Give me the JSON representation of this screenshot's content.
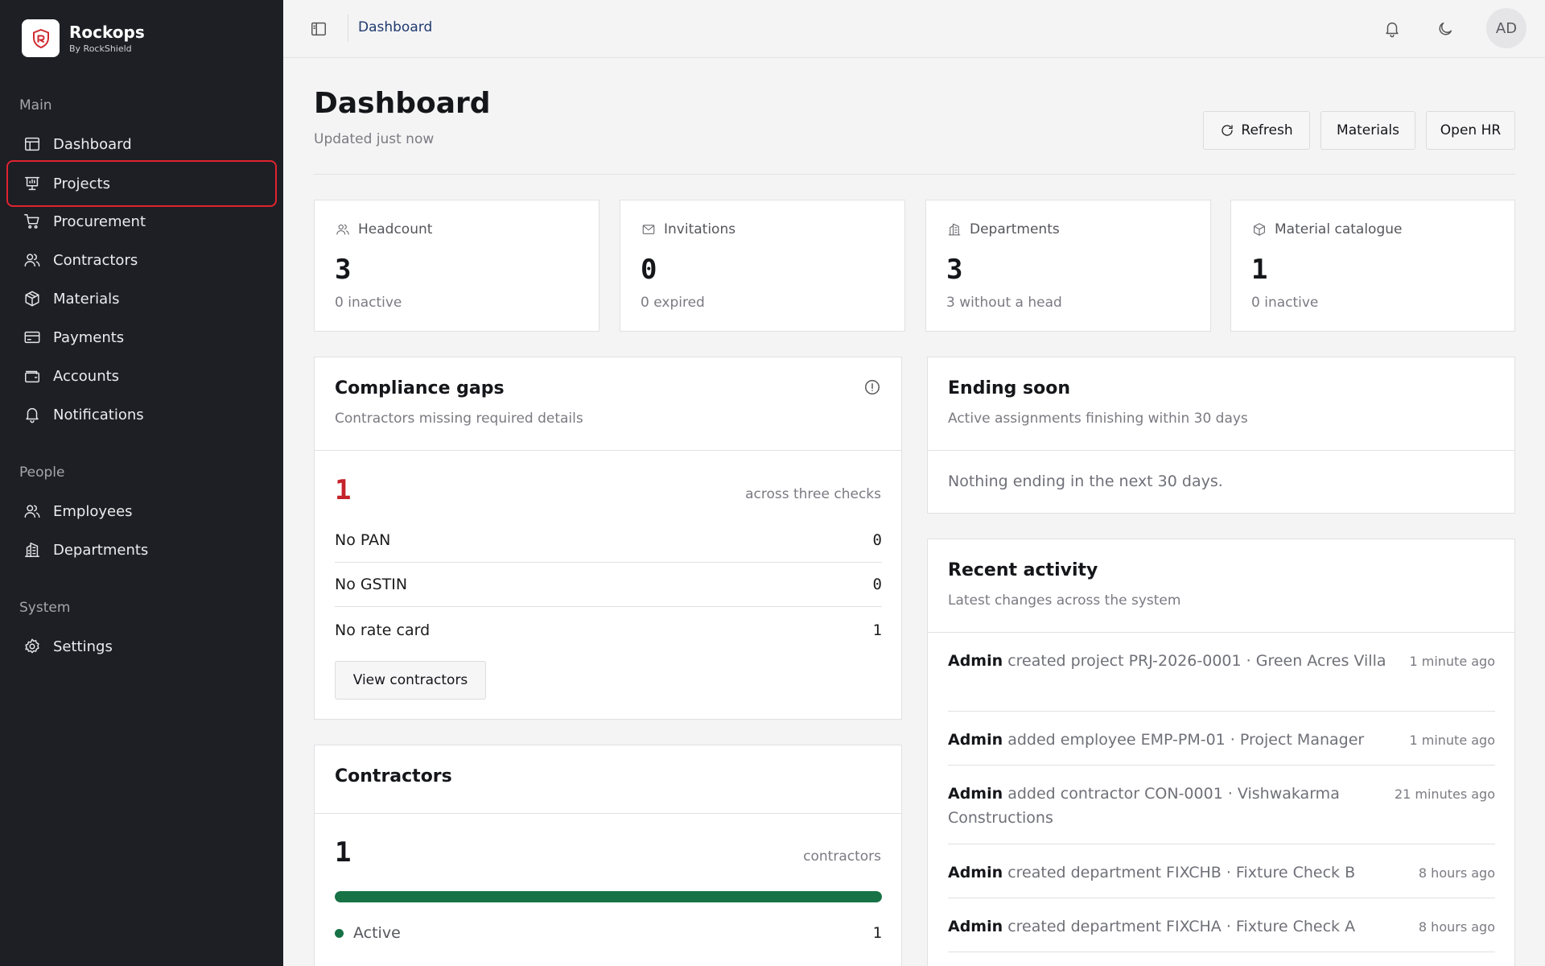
{
  "brand": {
    "name": "Rockops",
    "sub": "By RockShield"
  },
  "sidebar": {
    "groups": [
      {
        "label": "Main",
        "items": [
          {
            "label": "Dashboard",
            "icon": "layout-icon"
          },
          {
            "label": "Projects",
            "icon": "presentation-icon"
          },
          {
            "label": "Procurement",
            "icon": "cart-icon"
          },
          {
            "label": "Contractors",
            "icon": "users-icon"
          },
          {
            "label": "Materials",
            "icon": "package-icon"
          },
          {
            "label": "Payments",
            "icon": "credit-card-icon"
          },
          {
            "label": "Accounts",
            "icon": "wallet-icon"
          },
          {
            "label": "Notifications",
            "icon": "bell-icon"
          }
        ]
      },
      {
        "label": "People",
        "items": [
          {
            "label": "Employees",
            "icon": "users-icon"
          },
          {
            "label": "Departments",
            "icon": "building-icon"
          }
        ]
      },
      {
        "label": "System",
        "items": [
          {
            "label": "Settings",
            "icon": "gear-icon"
          }
        ]
      }
    ]
  },
  "topbar": {
    "breadcrumb": "Dashboard",
    "avatar": "AD"
  },
  "header": {
    "title": "Dashboard",
    "updated": "Updated just now",
    "buttons": {
      "refresh": "Refresh",
      "materials": "Materials",
      "open_hr": "Open HR"
    }
  },
  "stats": [
    {
      "label": "Headcount",
      "value": "3",
      "sub": "0 inactive",
      "icon": "users-icon"
    },
    {
      "label": "Invitations",
      "value": "0",
      "sub": "0 expired",
      "icon": "mail-icon"
    },
    {
      "label": "Departments",
      "value": "3",
      "sub": "3 without a head",
      "icon": "building-icon"
    },
    {
      "label": "Material catalogue",
      "value": "1",
      "sub": "0 inactive",
      "icon": "package-icon"
    }
  ],
  "compliance": {
    "title": "Compliance gaps",
    "subtitle": "Contractors missing required details",
    "total": "1",
    "note": "across three checks",
    "checks": [
      {
        "label": "No PAN",
        "count": "0"
      },
      {
        "label": "No GSTIN",
        "count": "0"
      },
      {
        "label": "No rate card",
        "count": "1"
      }
    ],
    "button": "View contractors"
  },
  "contractors": {
    "title": "Contractors",
    "total": "1",
    "note": "contractors",
    "active_fraction": 1.0,
    "legend": [
      {
        "label": "Active",
        "count": "1"
      }
    ]
  },
  "ending_soon": {
    "title": "Ending soon",
    "subtitle": "Active assignments finishing within 30 days",
    "empty": "Nothing ending in the next 30 days."
  },
  "activity": {
    "title": "Recent activity",
    "subtitle": "Latest changes across the system",
    "items": [
      {
        "actor": "Admin",
        "text": "created project PRJ-2026-0001 · Green Acres Villa",
        "time": "1 minute ago"
      },
      {
        "actor": "Admin",
        "text": "added employee EMP-PM-01 · Project Manager",
        "time": "1 minute ago"
      },
      {
        "actor": "Admin",
        "text": "added contractor CON-0001 · Vishwakarma Constructions",
        "time": "21 minutes ago"
      },
      {
        "actor": "Admin",
        "text": "created department FIXCHB · Fixture Check B",
        "time": "8 hours ago"
      },
      {
        "actor": "Admin",
        "text": "created department FIXCHA · Fixture Check A",
        "time": "8 hours ago"
      }
    ]
  },
  "colors": {
    "sidebar_bg": "#1d1f25",
    "accent_red": "#c5222b",
    "success_green": "#177245",
    "link_blue": "#1f3a6e"
  }
}
